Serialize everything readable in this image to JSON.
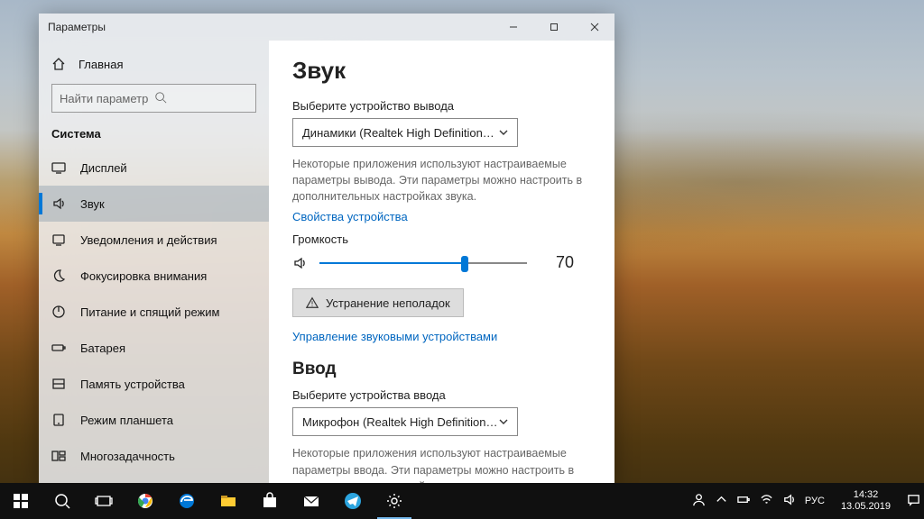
{
  "window": {
    "title": "Параметры"
  },
  "sidebar": {
    "home": "Главная",
    "search_placeholder": "Найти параметр",
    "section": "Система",
    "items": [
      {
        "label": "Дисплей"
      },
      {
        "label": "Звук"
      },
      {
        "label": "Уведомления и действия"
      },
      {
        "label": "Фокусировка внимания"
      },
      {
        "label": "Питание и спящий режим"
      },
      {
        "label": "Батарея"
      },
      {
        "label": "Память устройства"
      },
      {
        "label": "Режим планшета"
      },
      {
        "label": "Многозадачность"
      }
    ]
  },
  "content": {
    "title": "Звук",
    "out_label": "Выберите устройство вывода",
    "out_value": "Динамики (Realtek High Definition…",
    "out_desc": "Некоторые приложения используют настраиваемые параметры вывода. Эти параметры можно настроить в дополнительных настройках звука.",
    "out_props": "Свойства устройства",
    "vol_label": "Громкость",
    "vol_value": "70",
    "troubleshoot": "Устранение неполадок",
    "manage": "Управление звуковыми устройствами",
    "in_title": "Ввод",
    "in_label": "Выберите устройства ввода",
    "in_value": "Микрофон (Realtek High Definition…",
    "in_desc": "Некоторые приложения используют настраиваемые параметры ввода. Эти параметры можно настроить в дополнительных настройках звука."
  },
  "taskbar": {
    "lang": "РУС",
    "time": "14:32",
    "date": "13.05.2019"
  }
}
